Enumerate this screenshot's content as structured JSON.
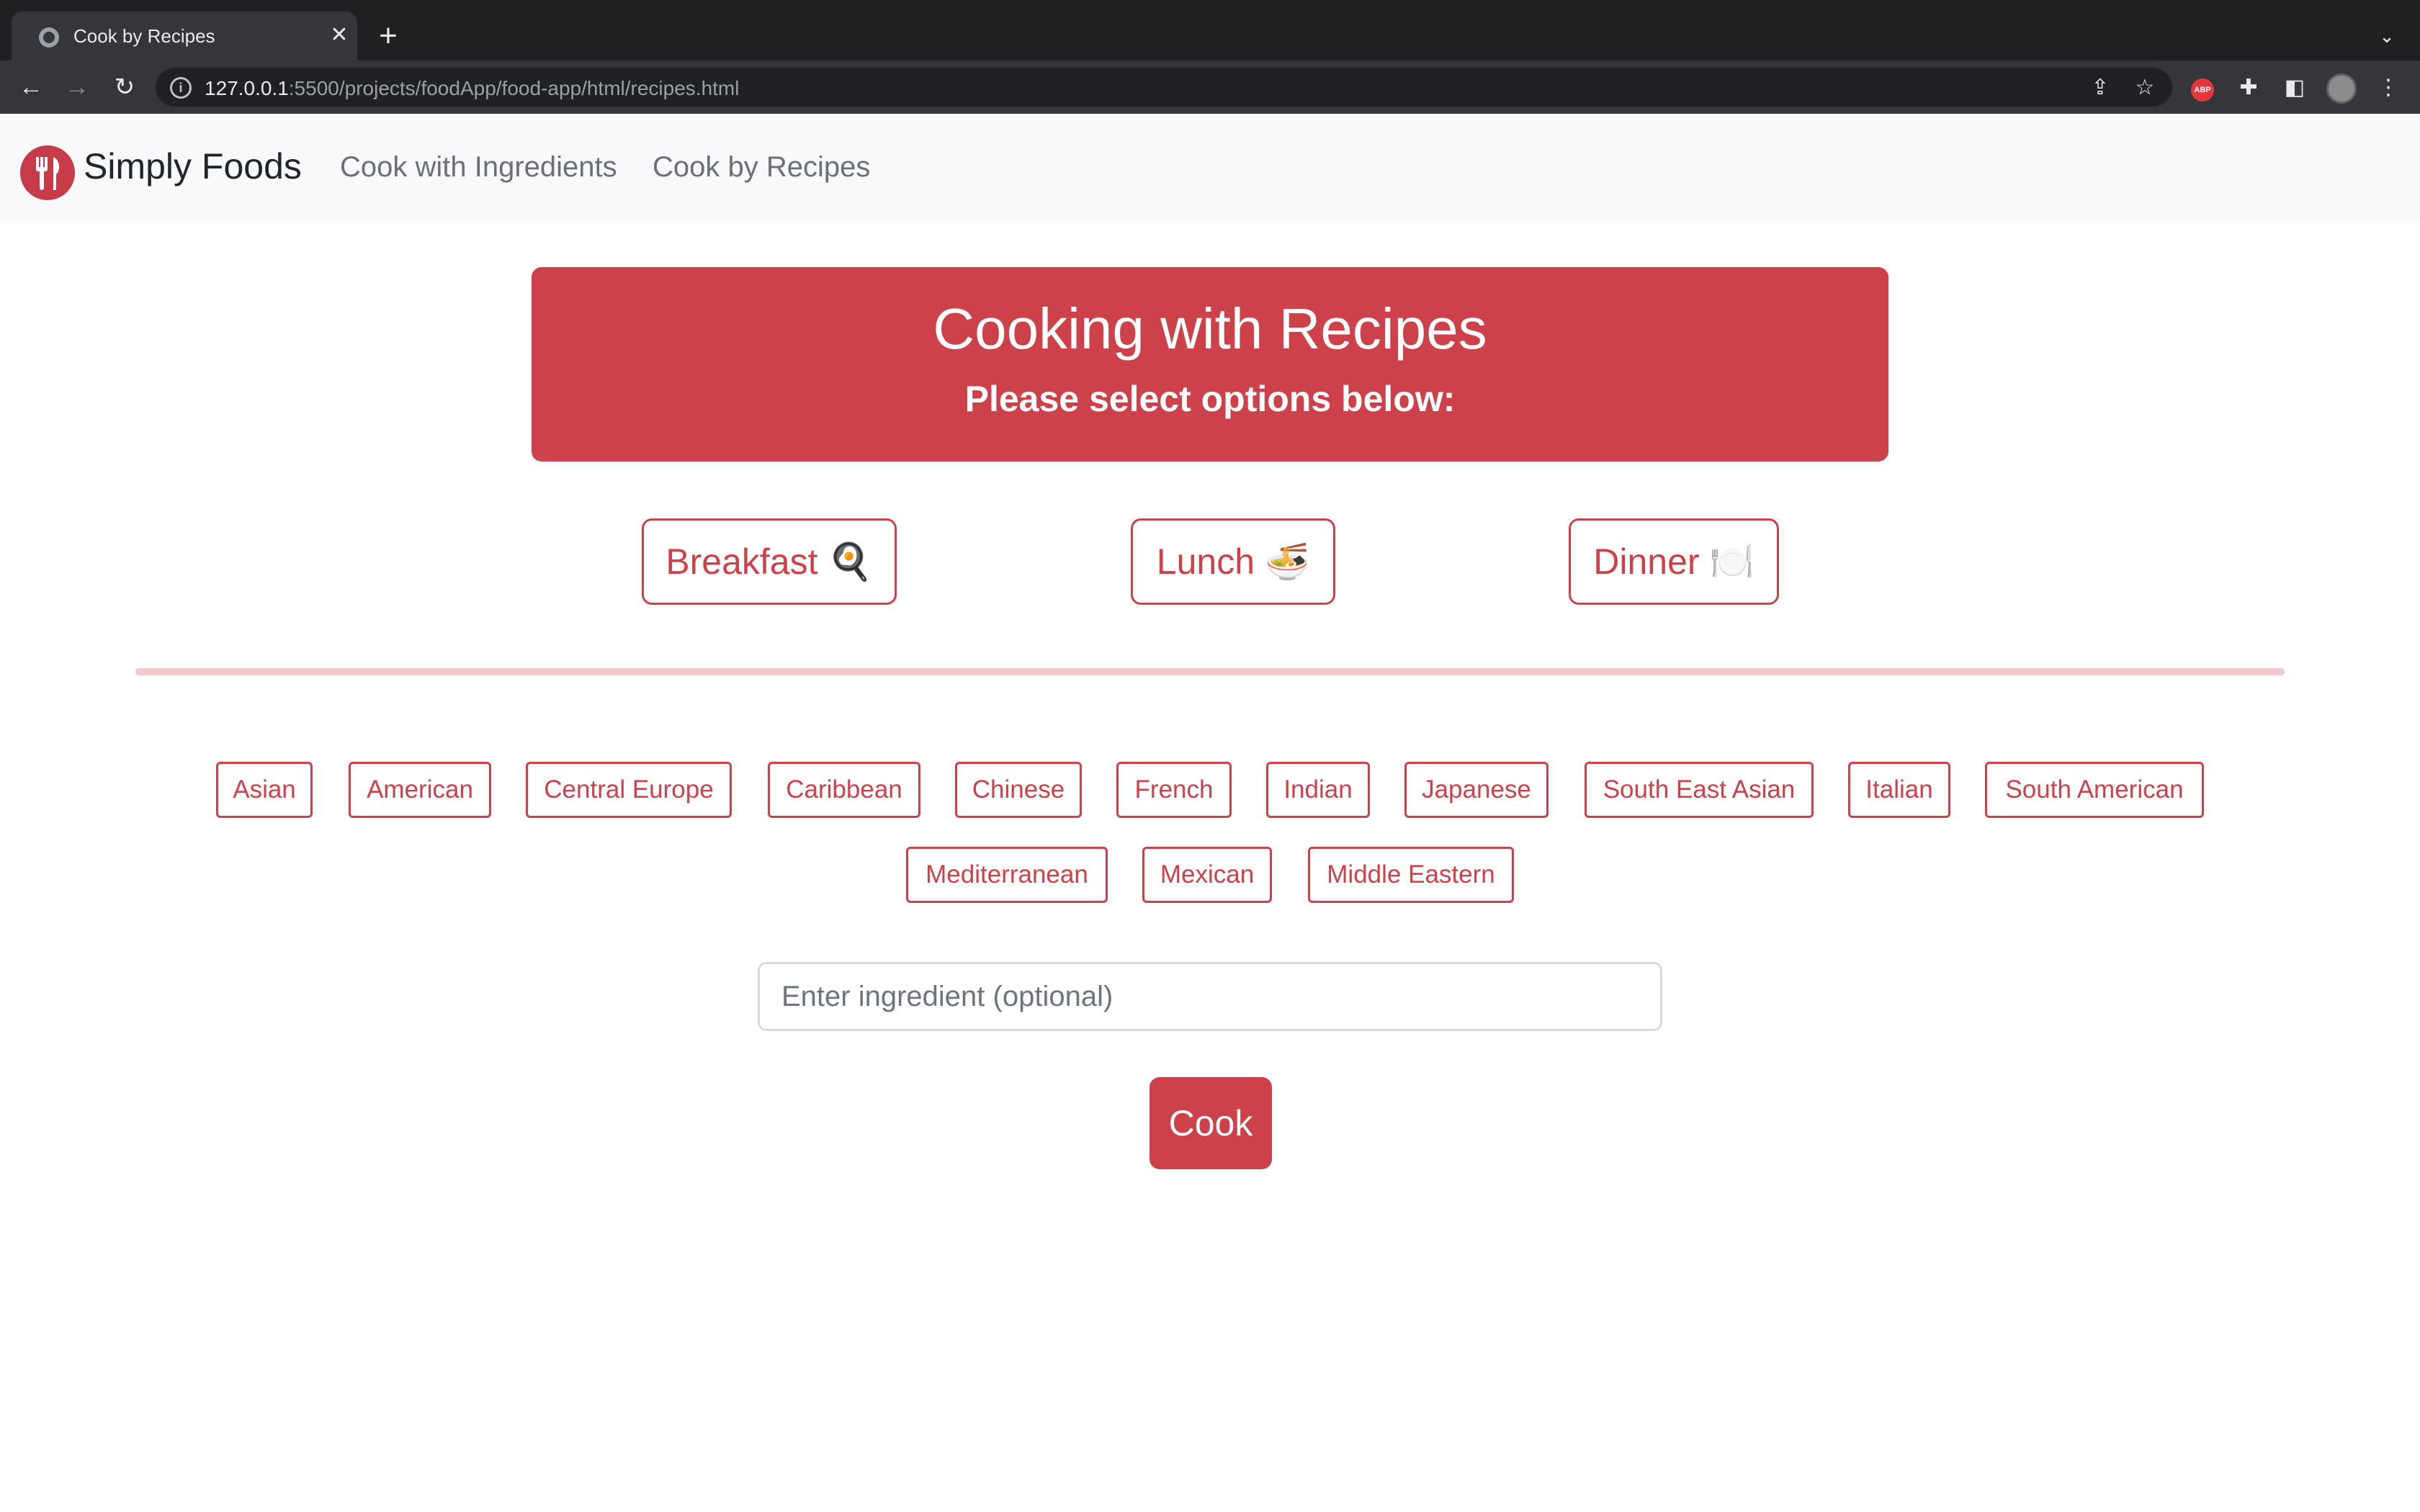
{
  "browser": {
    "tab_title": "Cook by Recipes",
    "url_host": "127.0.0.1",
    "url_path": ":5500/projects/foodApp/food-app/html/recipes.html",
    "extension_badge": "ABP"
  },
  "navbar": {
    "brand": "Simply Foods",
    "links": [
      "Cook with Ingredients",
      "Cook by Recipes"
    ]
  },
  "hero": {
    "title": "Cooking with Recipes",
    "subtitle": "Please select options below:"
  },
  "meals": [
    {
      "label": "Breakfast",
      "emoji": "🍳"
    },
    {
      "label": "Lunch",
      "emoji": "🍜"
    },
    {
      "label": "Dinner",
      "emoji": "🍽️"
    }
  ],
  "cuisines": [
    "Asian",
    "American",
    "Central Europe",
    "Caribbean",
    "Chinese",
    "French",
    "Indian",
    "Japanese",
    "South East Asian",
    "Italian",
    "South American",
    "Mediterranean",
    "Mexican",
    "Middle Eastern"
  ],
  "ingredient": {
    "placeholder": "Enter ingredient (optional)",
    "value": ""
  },
  "cook_label": "Cook",
  "colors": {
    "accent": "#cd414a",
    "navbar_bg": "#f8f9fa",
    "divider": "#f1c8cb"
  }
}
